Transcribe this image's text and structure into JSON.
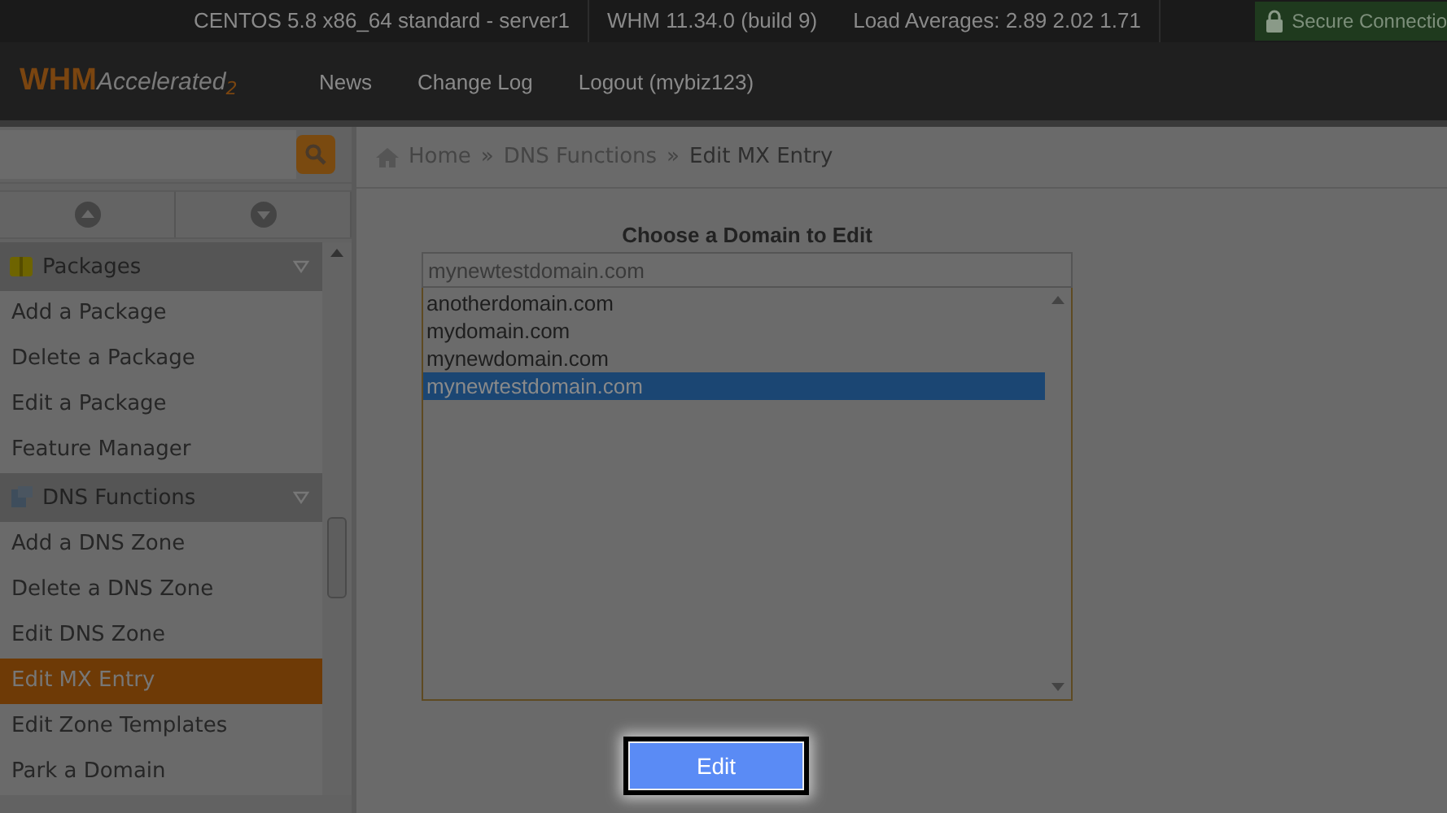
{
  "status_bar": {
    "items": [
      "CENTOS 5.8 x86_64 standard - server1",
      "WHM 11.34.0 (build 9)",
      "Load Averages: 2.89 2.02 1.71"
    ],
    "secure": "Secure Connectio"
  },
  "header": {
    "logo": {
      "main": "WHM",
      "sub": "Accelerated",
      "version": "2"
    },
    "nav": [
      "News",
      "Change Log",
      "Logout (mybiz123)"
    ]
  },
  "sidebar": {
    "sections": [
      {
        "title": "Packages",
        "kind": "packages",
        "items": [
          {
            "label": "Add a Package",
            "selected": false
          },
          {
            "label": "Delete a Package",
            "selected": false
          },
          {
            "label": "Edit a Package",
            "selected": false
          },
          {
            "label": "Feature Manager",
            "selected": false
          }
        ]
      },
      {
        "title": "DNS Functions",
        "kind": "dns",
        "items": [
          {
            "label": "Add a DNS Zone",
            "selected": false
          },
          {
            "label": "Delete a DNS Zone",
            "selected": false
          },
          {
            "label": "Edit DNS Zone",
            "selected": false
          },
          {
            "label": "Edit MX Entry",
            "selected": true
          },
          {
            "label": "Edit Zone Templates",
            "selected": false
          },
          {
            "label": "Park a Domain",
            "selected": false
          }
        ]
      }
    ]
  },
  "breadcrumb": {
    "separator": "»",
    "items": [
      "Home",
      "DNS Functions",
      "Edit MX Entry"
    ]
  },
  "form": {
    "title": "Choose a Domain to Edit",
    "filter": "mynewtestdomain.com",
    "options": [
      {
        "label": "anotherdomain.com",
        "selected": false
      },
      {
        "label": "mydomain.com",
        "selected": false
      },
      {
        "label": "mynewdomain.com",
        "selected": false
      },
      {
        "label": "mynewtestdomain.com",
        "selected": true
      }
    ],
    "button": "Edit"
  }
}
